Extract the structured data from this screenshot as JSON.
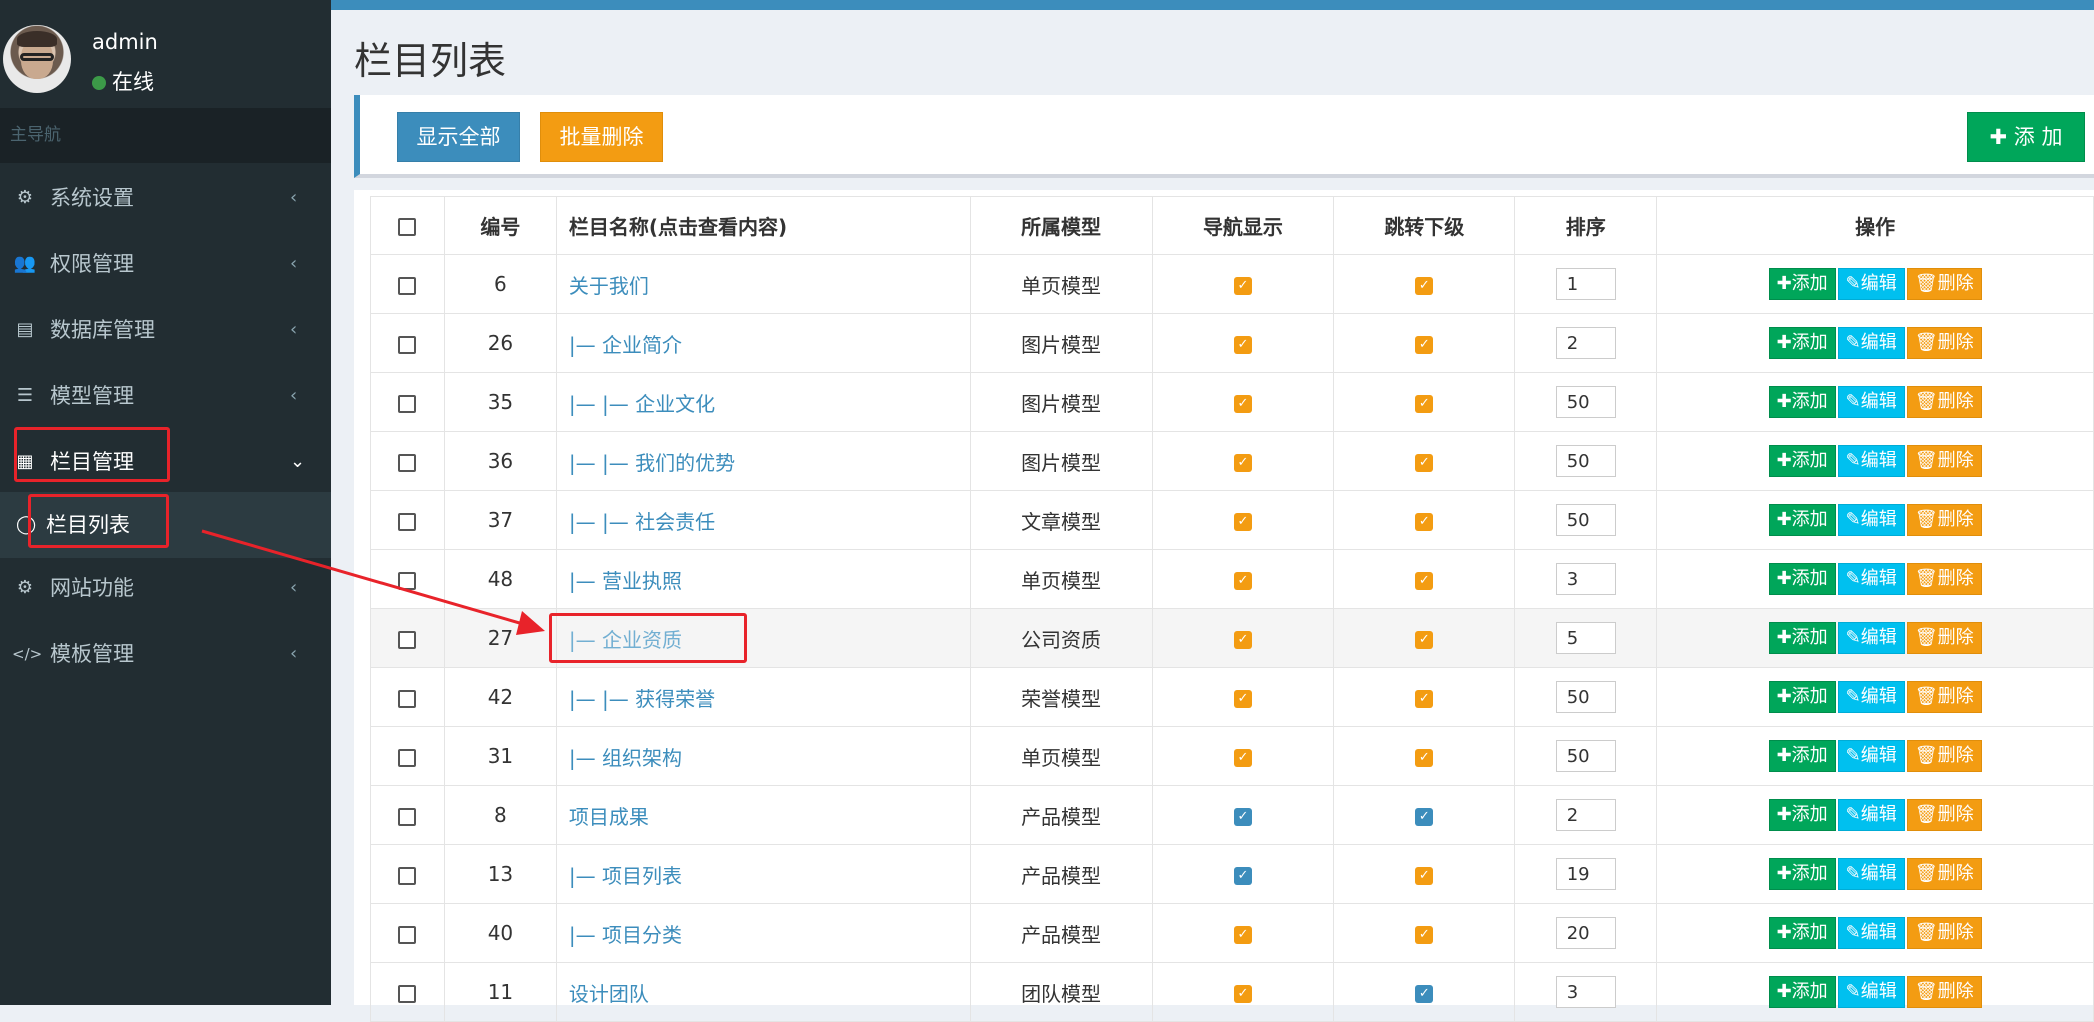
{
  "user": {
    "name": "admin",
    "status": "在线"
  },
  "sidebar": {
    "header": "主导航",
    "items": [
      {
        "label": "系统设置",
        "icon": "gears-icon",
        "glyph": "⚙"
      },
      {
        "label": "权限管理",
        "icon": "users-icon",
        "glyph": "👥"
      },
      {
        "label": "数据库管理",
        "icon": "database-icon",
        "glyph": "▤"
      },
      {
        "label": "模型管理",
        "icon": "list-icon",
        "glyph": "☰"
      },
      {
        "label": "栏目管理",
        "icon": "grid-icon",
        "glyph": "▦"
      },
      {
        "label": "网站功能",
        "icon": "gear-icon",
        "glyph": "⚙"
      },
      {
        "label": "模板管理",
        "icon": "code-icon",
        "glyph": "</>"
      }
    ],
    "sub_item": {
      "label": "栏目列表",
      "icon": "circle-icon",
      "glyph": "◯"
    }
  },
  "page": {
    "title": "栏目列表"
  },
  "toolbar": {
    "show_all": "显示全部",
    "batch_delete": "批量删除",
    "add": "✚ 添 加"
  },
  "table": {
    "headers": [
      "编号",
      "栏目名称(点击查看内容)",
      "所属模型",
      "导航显示",
      "跳转下级",
      "排序",
      "操作"
    ],
    "actions": {
      "add": "✚添加",
      "edit": "✎编辑",
      "delete": "🗑删除"
    },
    "rows": [
      {
        "id": "6",
        "name": "关于我们",
        "model": "单页模型",
        "nav": "orange",
        "jump": "orange",
        "sort": "1"
      },
      {
        "id": "26",
        "name": "|— 企业简介",
        "model": "图片模型",
        "nav": "orange",
        "jump": "orange",
        "sort": "2"
      },
      {
        "id": "35",
        "name": "|— |— 企业文化",
        "model": "图片模型",
        "nav": "orange",
        "jump": "orange",
        "sort": "50"
      },
      {
        "id": "36",
        "name": "|— |— 我们的优势",
        "model": "图片模型",
        "nav": "orange",
        "jump": "orange",
        "sort": "50"
      },
      {
        "id": "37",
        "name": "|— |— 社会责任",
        "model": "文章模型",
        "nav": "orange",
        "jump": "orange",
        "sort": "50"
      },
      {
        "id": "48",
        "name": "|— 营业执照",
        "model": "单页模型",
        "nav": "orange",
        "jump": "orange",
        "sort": "3"
      },
      {
        "id": "27",
        "name": "|— 企业资质",
        "model": "公司资质",
        "nav": "orange",
        "jump": "orange",
        "sort": "5"
      },
      {
        "id": "42",
        "name": "|— |— 获得荣誉",
        "model": "荣誉模型",
        "nav": "orange",
        "jump": "orange",
        "sort": "50"
      },
      {
        "id": "31",
        "name": "|— 组织架构",
        "model": "单页模型",
        "nav": "orange",
        "jump": "orange",
        "sort": "50"
      },
      {
        "id": "8",
        "name": "项目成果",
        "model": "产品模型",
        "nav": "blue",
        "jump": "blue",
        "sort": "2"
      },
      {
        "id": "13",
        "name": "|— 项目列表",
        "model": "产品模型",
        "nav": "blue",
        "jump": "orange",
        "sort": "19"
      },
      {
        "id": "40",
        "name": "|— 项目分类",
        "model": "产品模型",
        "nav": "orange",
        "jump": "orange",
        "sort": "20"
      },
      {
        "id": "11",
        "name": "设计团队",
        "model": "团队模型",
        "nav": "orange",
        "jump": "blue",
        "sort": "3"
      }
    ]
  },
  "colors": {
    "accent": "#3c8dbc",
    "success": "#00a65a",
    "warning": "#f39c12",
    "info": "#00c0ef",
    "sidebar": "#222d32",
    "highlight": "#e8232a"
  }
}
